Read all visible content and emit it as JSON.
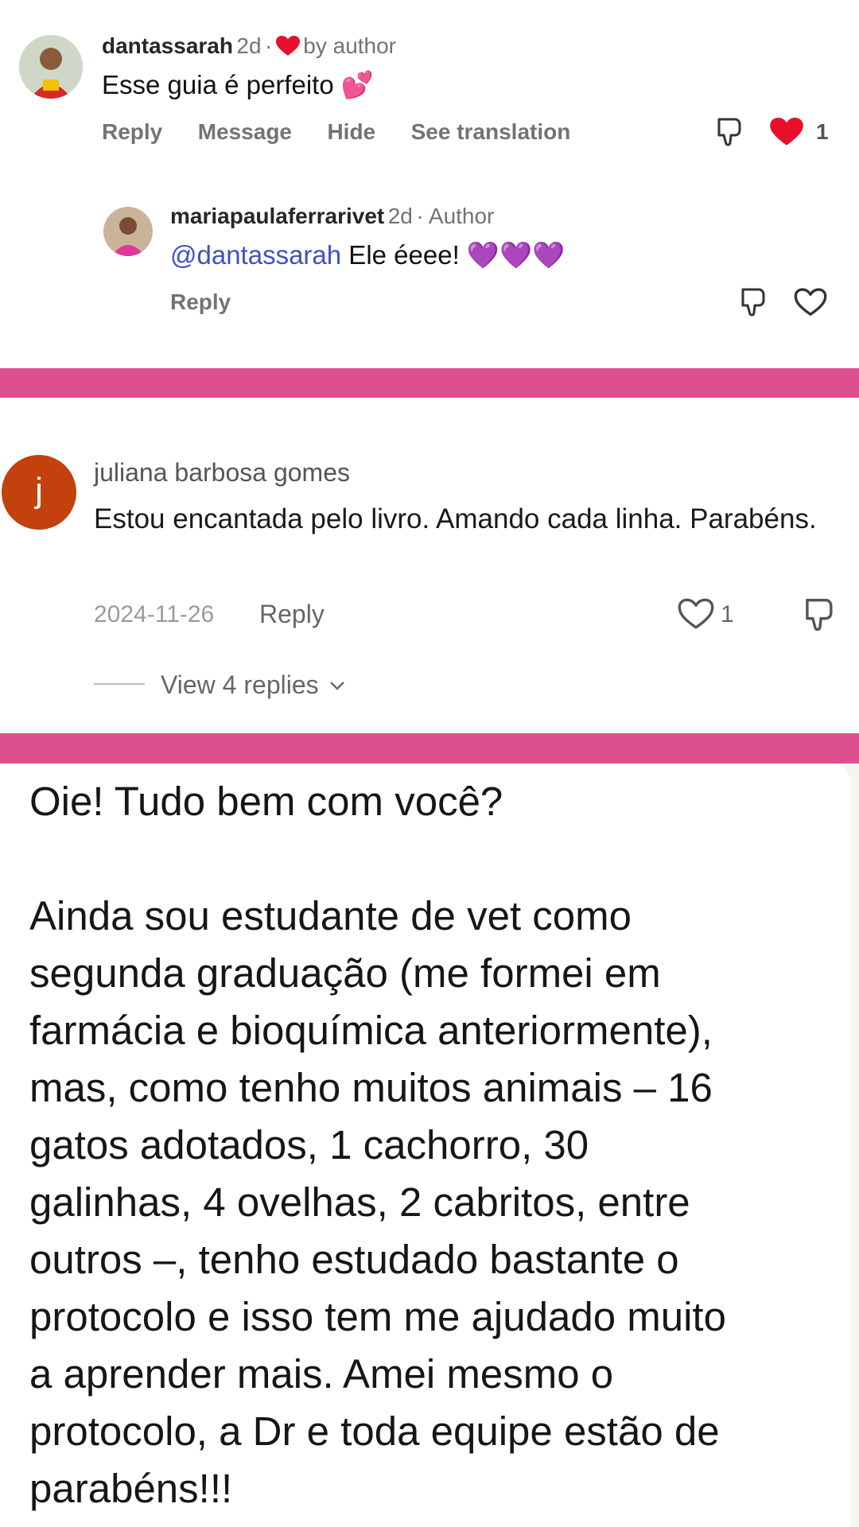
{
  "comment1": {
    "username": "dantassarah",
    "time": "2d",
    "dot": "·",
    "by_author": "by author",
    "text": "Esse guia é perfeito",
    "emoji": "💕",
    "actions": [
      "Reply",
      "Message",
      "Hide",
      "See translation"
    ],
    "like_count": "1"
  },
  "reply1": {
    "username": "mariapaulaferrarivet",
    "time": "2d",
    "meta": "· Author",
    "mention": "@dantassarah",
    "text": " Ele éeee! ",
    "emoji": "💜💜💜",
    "reply_label": "Reply"
  },
  "comment2": {
    "avatar_letter": "j",
    "username": "juliana barbosa gomes",
    "text": "Estou encantada pelo livro. Amando cada linha. Parabéns.",
    "date": "2024-11-26",
    "reply_label": "Reply",
    "like_count": "1",
    "view_replies": "View 4 replies"
  },
  "message": {
    "text": "Oie! Tudo bem com você?\n\nAinda sou estudante de vet como\nsegunda graduação (me formei em\nfarmácia e bioquímica anteriormente),\nmas, como tenho muitos animais – 16\ngatos adotados, 1 cachorro, 30\ngalinhas, 4 ovelhas, 2 cabritos, entre\noutros –, tenho estudado bastante o\nprotocolo e isso tem me ajudado muito\na aprender mais. Amei mesmo o\nprotocolo, a Dr e toda equipe estão de\nparabéns!!!"
  },
  "colors": {
    "divider": "#de4f8d",
    "heart_red": "#e8102a",
    "mention_blue": "#3f51c6",
    "avatar_j": "#c2410c"
  }
}
